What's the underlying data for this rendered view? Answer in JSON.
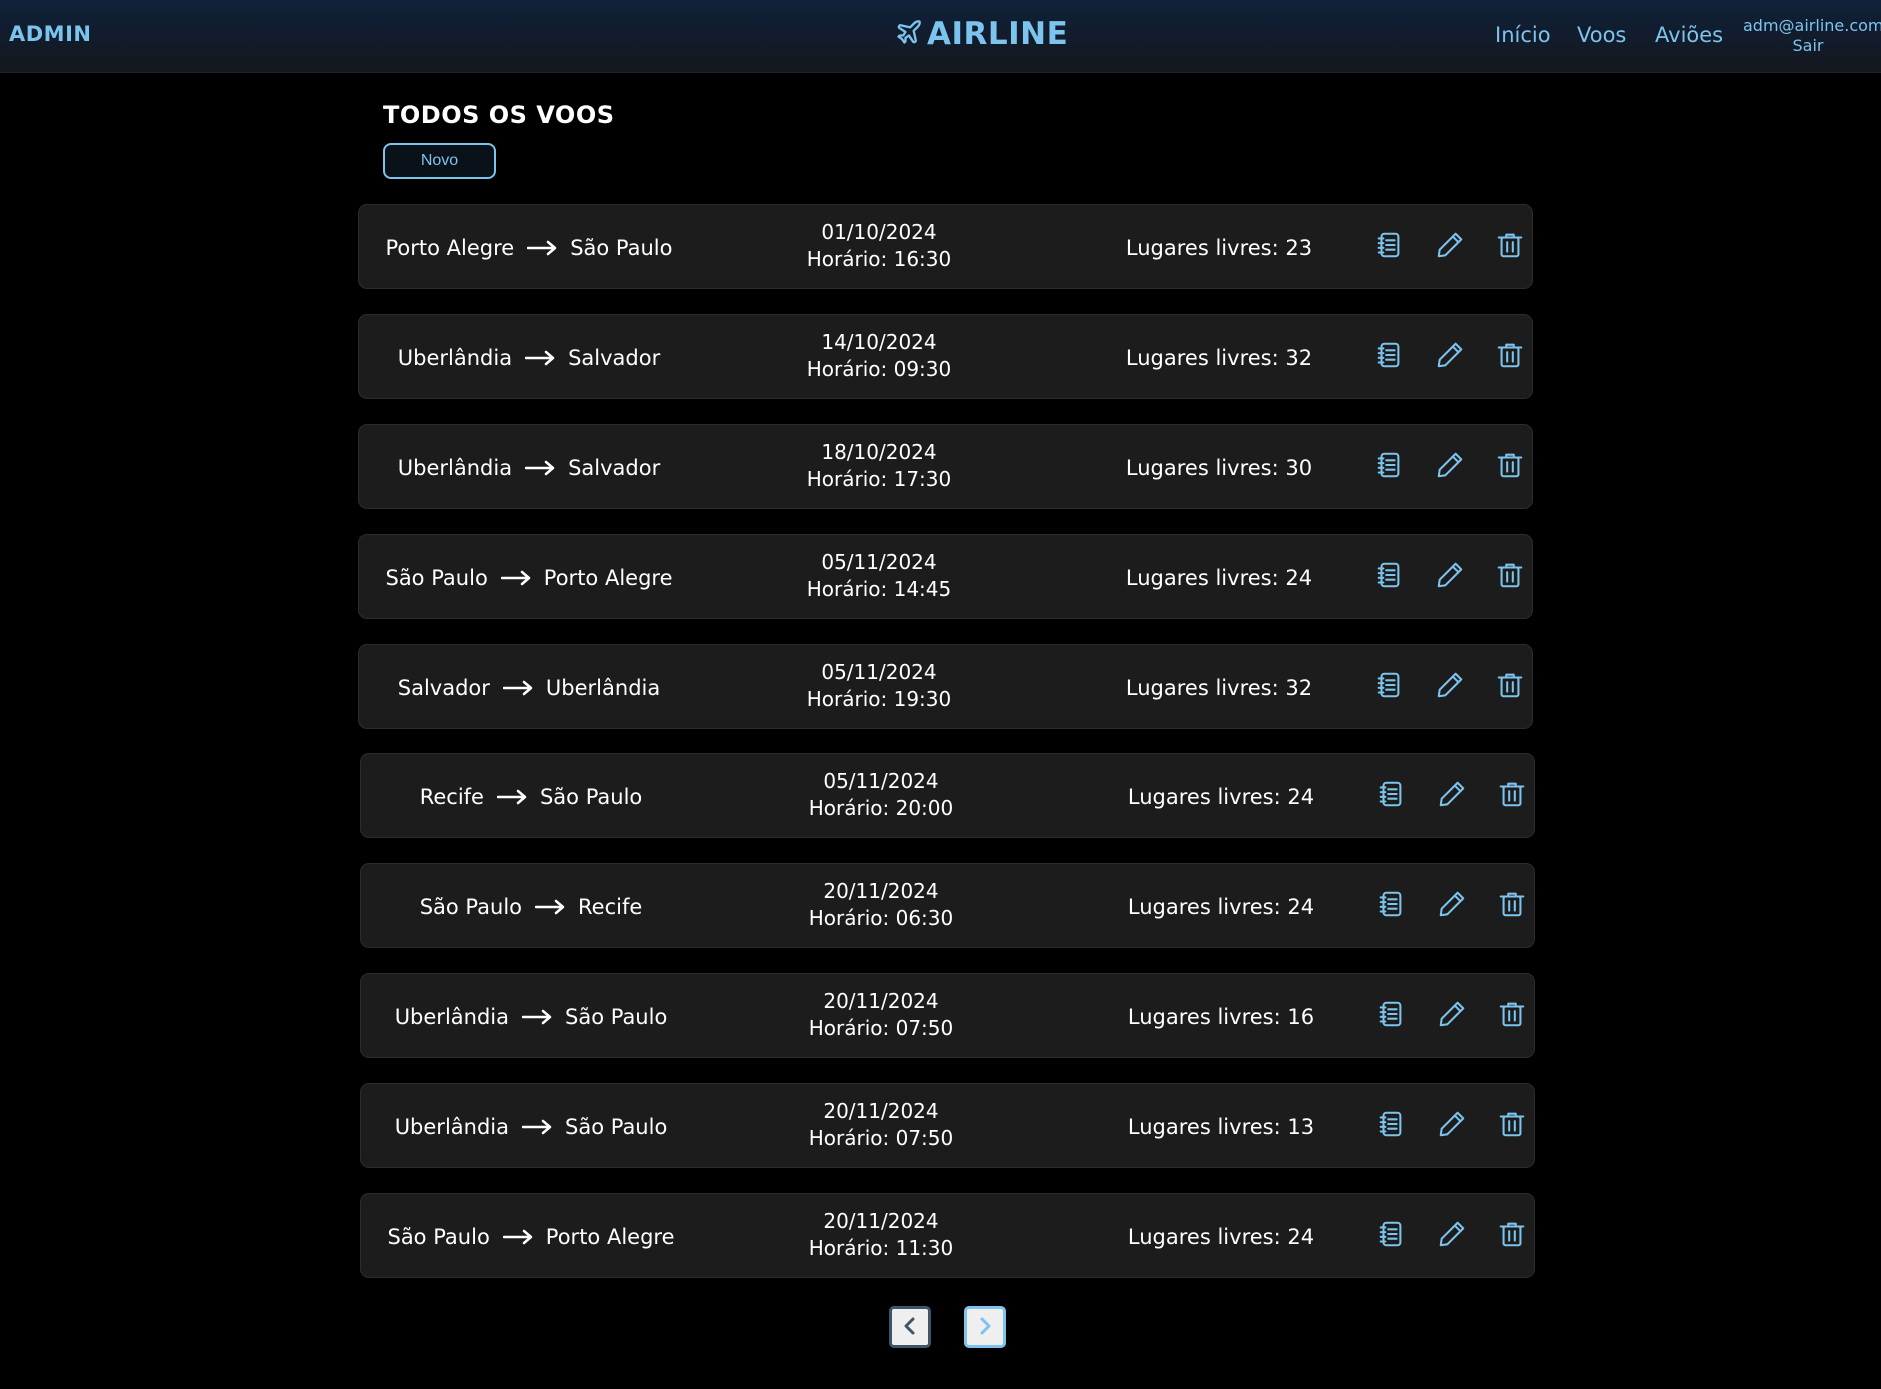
{
  "header": {
    "admin_label": "ADMIN",
    "brand_name": "AIRLINE",
    "brand_icon": "plane-icon",
    "nav": [
      {
        "label": "Início"
      },
      {
        "label": "Voos"
      },
      {
        "label": "Aviões"
      }
    ],
    "user_email": "adm@airline.com",
    "logout_label": "Sair"
  },
  "page": {
    "title": "TODOS OS VOOS",
    "new_button_label": "Novo"
  },
  "flights": [
    {
      "origin": "Porto Alegre",
      "destination": "São Paulo",
      "date": "01/10/2024",
      "time": "Horário: 16:30",
      "seats": "Lugares livres: 23"
    },
    {
      "origin": "Uberlândia",
      "destination": "Salvador",
      "date": "14/10/2024",
      "time": "Horário: 09:30",
      "seats": "Lugares livres: 32"
    },
    {
      "origin": "Uberlândia",
      "destination": "Salvador",
      "date": "18/10/2024",
      "time": "Horário: 17:30",
      "seats": "Lugares livres: 30"
    },
    {
      "origin": "São Paulo",
      "destination": "Porto Alegre",
      "date": "05/11/2024",
      "time": "Horário: 14:45",
      "seats": "Lugares livres: 24"
    },
    {
      "origin": "Salvador",
      "destination": "Uberlândia",
      "date": "05/11/2024",
      "time": "Horário: 19:30",
      "seats": "Lugares livres: 32"
    },
    {
      "origin": "Recife",
      "destination": "São Paulo",
      "date": "05/11/2024",
      "time": "Horário: 20:00",
      "seats": "Lugares livres: 24"
    },
    {
      "origin": "São Paulo",
      "destination": "Recife",
      "date": "20/11/2024",
      "time": "Horário: 06:30",
      "seats": "Lugares livres: 24"
    },
    {
      "origin": "Uberlândia",
      "destination": "São Paulo",
      "date": "20/11/2024",
      "time": "Horário: 07:50",
      "seats": "Lugares livres: 16"
    },
    {
      "origin": "Uberlândia",
      "destination": "São Paulo",
      "date": "20/11/2024",
      "time": "Horário: 07:50",
      "seats": "Lugares livres: 13"
    },
    {
      "origin": "São Paulo",
      "destination": "Porto Alegre",
      "date": "20/11/2024",
      "time": "Horário: 11:30",
      "seats": "Lugares livres: 24"
    }
  ],
  "row_icons": [
    "details-icon",
    "edit-pencil-icon",
    "delete-trash-icon"
  ],
  "pagination": {
    "prev_icon": "chevron-left-icon",
    "next_icon": "chevron-right-icon",
    "prev_enabled": false,
    "next_enabled": true
  },
  "colors": {
    "accent": "#7cc4ee",
    "background": "#000000",
    "row_background": "#1c1c1c",
    "header_top": "#0f213a",
    "text": "#ffffff",
    "disabled": "#3e5568"
  }
}
